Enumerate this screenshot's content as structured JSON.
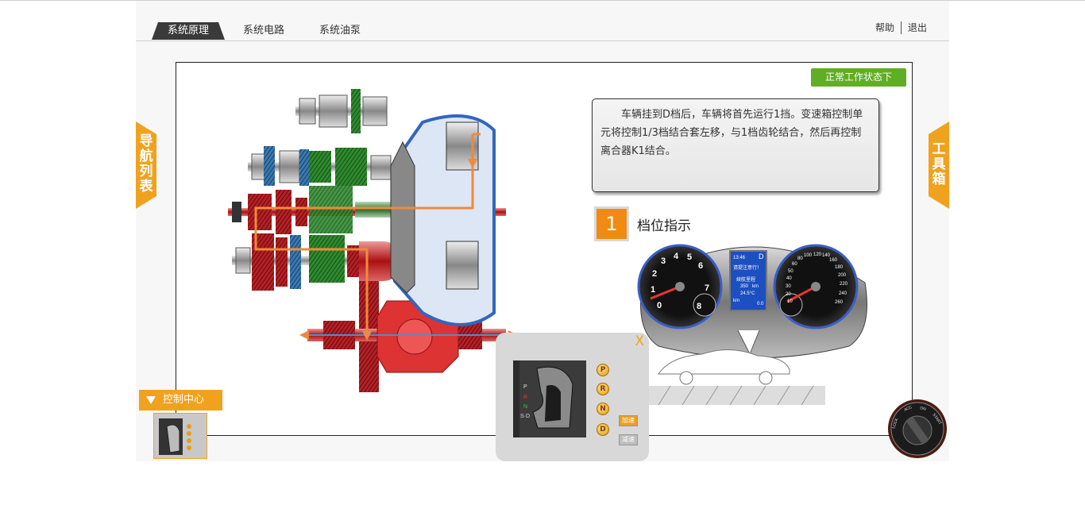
{
  "tabs": [
    "系统原理",
    "系统电路",
    "系统油泵"
  ],
  "top_links": {
    "help": "帮助",
    "exit": "退出"
  },
  "side_left": [
    "导",
    "航",
    "列",
    "表"
  ],
  "side_right": [
    "工",
    "具",
    "箱"
  ],
  "status_button": "正常工作状态下",
  "description": "车辆挂到D档后，车辆将首先运行1挡。变速箱控制单元将控制1/3档结合套左移，与1档齿轮结合，然后再控制离合器K1结合。",
  "step": {
    "number": "1",
    "title": "档位指示"
  },
  "dashboard": {
    "time": "13:46",
    "gear": "D",
    "line1": "请提注意行！",
    "line2": "续航里程",
    "range": "350",
    "range_unit": "km",
    "temp": "24.5°C",
    "bottom_left": "km",
    "bottom_right": "0.0",
    "rpm_ticks": [
      "0",
      "1",
      "2",
      "3",
      "4",
      "5",
      "6",
      "7",
      "8"
    ],
    "speed_ticks": [
      "10",
      "20",
      "30",
      "40",
      "50",
      "60",
      "80",
      "100",
      "120",
      "140",
      "160",
      "180",
      "200",
      "220",
      "240",
      "260"
    ]
  },
  "control_center": "控制中心",
  "popup": {
    "close": "X",
    "gears": [
      "P",
      "R",
      "N",
      "D"
    ],
    "accelerate": "加速",
    "decelerate": "减速",
    "shift_labels": [
      "P",
      "R",
      "N",
      "S·D"
    ]
  },
  "knob_labels": [
    "LOCK",
    "ACC",
    "ON",
    "START"
  ],
  "colors": {
    "accent": "#f0a21e",
    "status_green": "#5fae24",
    "step_orange": "#f08a12"
  }
}
